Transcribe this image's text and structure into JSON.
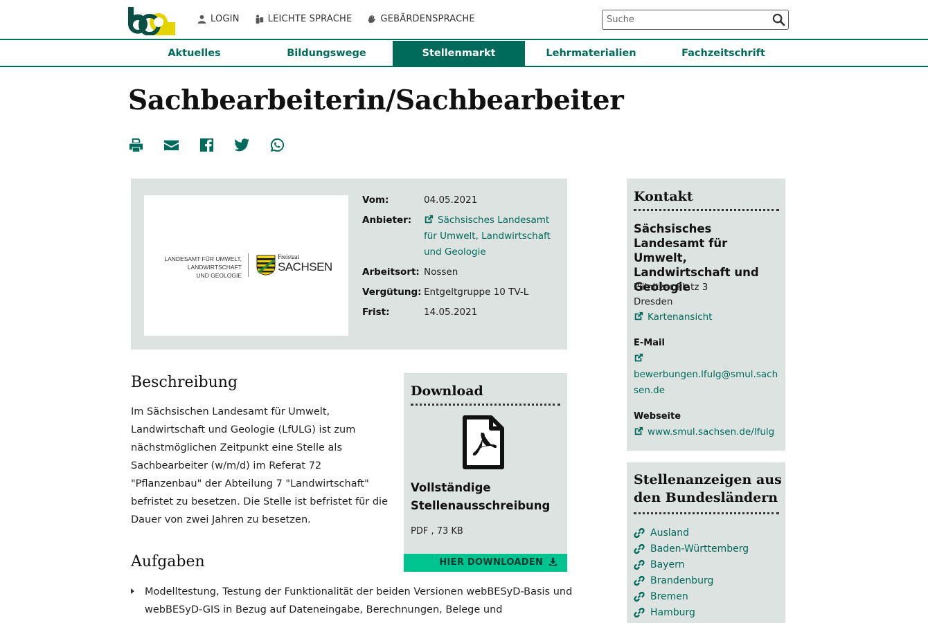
{
  "header": {
    "login": "LOGIN",
    "leichte_sprache": "LEICHTE SPRACHE",
    "gebaerdensprache": "GEBÄRDENSPRACHE",
    "search_placeholder": "Suche"
  },
  "nav": {
    "items": [
      {
        "label": "Aktuelles"
      },
      {
        "label": "Bildungswege"
      },
      {
        "label": "Stellenmarkt",
        "active": true
      },
      {
        "label": "Lehrmaterialien"
      },
      {
        "label": "Fachzeitschrift"
      }
    ]
  },
  "title": "Sachbearbeiterin/Sachbearbeiter",
  "logo_text": {
    "lfulg_line1": "LANDESAMT FÜR UMWELT,",
    "lfulg_line2": "LANDWIRTSCHAFT",
    "lfulg_line3": "UND GEOLOGIE",
    "freistaat": "Freistaat",
    "sachsen": "SACHSEN"
  },
  "info": {
    "vom_label": "Vom:",
    "vom": "04.05.2021",
    "anbieter_label": "Anbieter:",
    "anbieter": "Sächsisches Landesamt für Umwelt, Landwirtschaft und Geologie",
    "arbeitsort_label": "Arbeitsort:",
    "arbeitsort": "Nossen",
    "verguetung_label": "Vergütung:",
    "verguetung": "Entgeltgruppe 10 TV-L",
    "frist_label": "Frist:",
    "frist": "14.05.2021"
  },
  "beschreibung": {
    "title": "Beschreibung",
    "text": "Im Sächsischen Landesamt für Umwelt, Landwirtschaft und Geologie (LfULG) ist zum nächstmöglichen Zeitpunkt eine Stelle als Sachbearbeiter (w/m/d) im Referat 72 \"Pflanzenbau\" der Abteilung 7 \"Landwirtschaft\" befristet zu besetzen. Die Stelle ist befristet für die Dauer von zwei Jahren zu besetzen."
  },
  "aufgaben": {
    "title": "Aufgaben",
    "items": [
      "Modelltestung, Testung der Funktionalität der beiden Versionen webBESyD-Basis und webBESyD-GIS in Bezug auf Dateneingabe, Berechnungen, Belege und"
    ]
  },
  "download": {
    "title": "Download",
    "name": "Vollständige Stellenausschreibung",
    "meta": "PDF , 73 KB",
    "button": "HIER DOWNLOADEN"
  },
  "kontakt": {
    "title": "Kontakt",
    "org": "Sächsisches Landesamt für Umwelt, Landwirtschaft und Geologie",
    "street": "Pillnitzer Platz 3",
    "city": "Dresden",
    "map_link": "Kartenansicht",
    "email_label": "E-Mail",
    "email": "bewerbungen.lfulg@smul.sachsen.de",
    "web_label": "Webseite",
    "web": "www.smul.sachsen.de/lfulg"
  },
  "bundeslaender": {
    "title": "Stellenanzeigen aus den Bundesländern",
    "items": [
      "Ausland",
      "Baden-Württemberg",
      "Bayern",
      "Brandenburg",
      "Bremen",
      "Hamburg"
    ]
  },
  "colors": {
    "brand_green": "#006b5b",
    "box_grey": "#dde3e1",
    "download_green": "#00c48f",
    "logo_yellow": "#e6d400"
  }
}
